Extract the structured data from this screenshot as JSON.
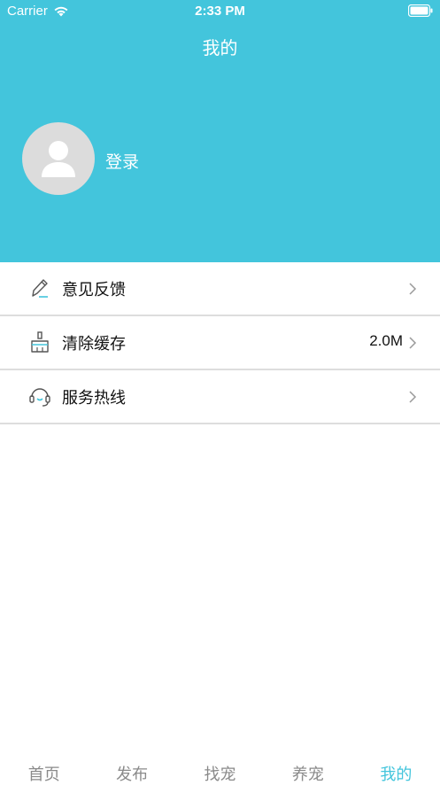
{
  "status_bar": {
    "carrier": "Carrier",
    "time": "2:33 PM",
    "wifi_icon": "wifi-icon",
    "battery_icon": "battery-icon"
  },
  "header": {
    "title": "我的",
    "background_color": "#43c5dc",
    "login_label": "登录",
    "avatar_icon": "user-avatar-icon"
  },
  "menu": [
    {
      "label": "意见反馈",
      "icon": "pencil-icon",
      "value": ""
    },
    {
      "label": "清除缓存",
      "icon": "broom-icon",
      "value": "2.0M"
    },
    {
      "label": "服务热线",
      "icon": "headset-icon",
      "value": ""
    }
  ],
  "tab_bar": {
    "tabs": [
      "首页",
      "发布",
      "找宠",
      "养宠",
      "我的"
    ],
    "active": "我的",
    "active_color": "#43c5dc",
    "inactive_color": "#8a8a8a"
  }
}
